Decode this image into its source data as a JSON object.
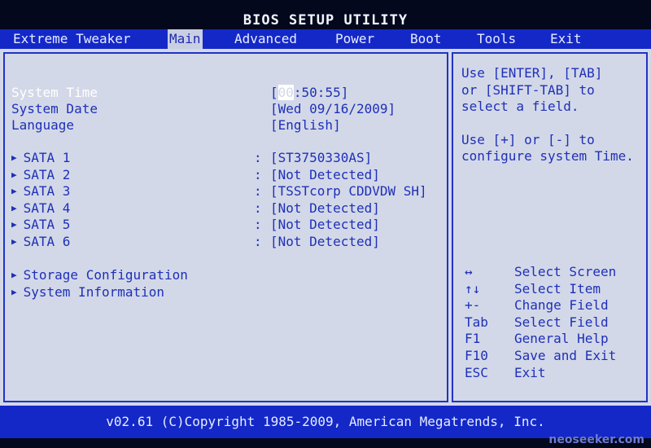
{
  "title": "BIOS SETUP UTILITY",
  "tabs": [
    {
      "label": "Extreme Tweaker"
    },
    {
      "label": "Main"
    },
    {
      "label": "Advanced"
    },
    {
      "label": "Power"
    },
    {
      "label": "Boot"
    },
    {
      "label": "Tools"
    },
    {
      "label": "Exit"
    }
  ],
  "main": {
    "system_time": {
      "label": "System Time",
      "value_cursor": "00",
      "value_rest": ":50:55]",
      "open": "["
    },
    "system_date": {
      "label": "System Date",
      "value": "[Wed 09/16/2009]"
    },
    "language": {
      "label": "Language",
      "value": "[English]"
    },
    "sata": [
      {
        "label": "SATA 1",
        "value": "[ST3750330AS]"
      },
      {
        "label": "SATA 2",
        "value": "[Not Detected]"
      },
      {
        "label": "SATA 3",
        "value": "[TSSTcorp CDDVDW SH]"
      },
      {
        "label": "SATA 4",
        "value": "[Not Detected]"
      },
      {
        "label": "SATA 5",
        "value": "[Not Detected]"
      },
      {
        "label": "SATA 6",
        "value": "[Not Detected]"
      }
    ],
    "colon": ":",
    "submenus": [
      {
        "label": "Storage Configuration"
      },
      {
        "label": "System Information"
      }
    ]
  },
  "help": {
    "line1": "Use [ENTER], [TAB]",
    "line2": "or [SHIFT-TAB] to",
    "line3": "select a field.",
    "line4": "Use [+] or [-] to",
    "line5": "configure system Time.",
    "keys": [
      {
        "key": "↔",
        "desc": "Select Screen"
      },
      {
        "key": "↑↓",
        "desc": "Select Item"
      },
      {
        "key": "+-",
        "desc": "Change Field"
      },
      {
        "key": "Tab",
        "desc": "Select Field"
      },
      {
        "key": "F1",
        "desc": "General Help"
      },
      {
        "key": "F10",
        "desc": "Save and Exit"
      },
      {
        "key": "ESC",
        "desc": "Exit"
      }
    ]
  },
  "footer": "v02.61 (C)Copyright 1985-2009, American Megatrends, Inc.",
  "watermark": "neoseeker.com",
  "icons": {
    "submenu_arrow": "▶"
  }
}
